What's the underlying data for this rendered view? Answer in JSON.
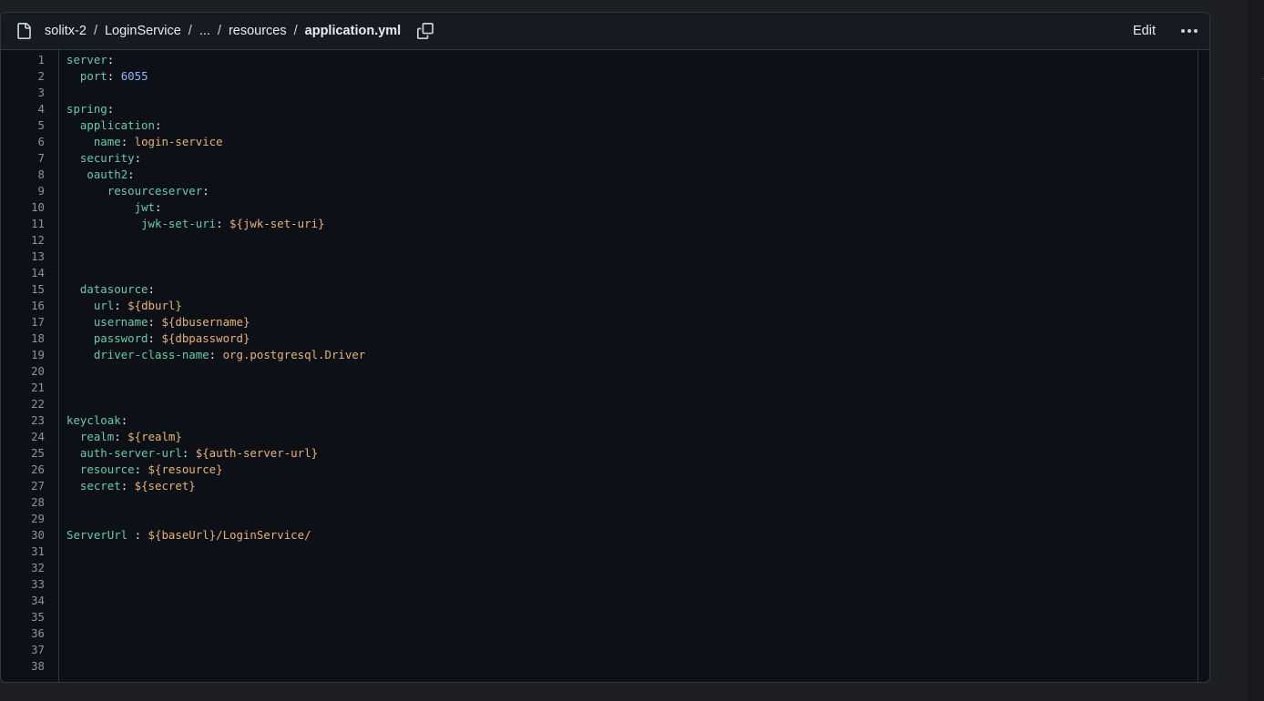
{
  "breadcrumb": {
    "repo": "solitx-2",
    "folder": "LoginService",
    "ellipsis": "...",
    "subfolder": "resources",
    "file": "application.yml",
    "separator": "/"
  },
  "header": {
    "edit_label": "Edit"
  },
  "icons": {
    "file": "file-icon",
    "copy": "copy-icon",
    "more": "kebab-more-icon"
  },
  "colors": {
    "key": "#6bc9a6",
    "string": "#e8b27a",
    "number": "#8fb4ff",
    "background": "#0d1117"
  },
  "code_lines": [
    [
      {
        "t": "k",
        "s": "server"
      },
      {
        "t": "p",
        "s": ":"
      }
    ],
    [
      {
        "t": "p",
        "s": "  "
      },
      {
        "t": "k",
        "s": "port"
      },
      {
        "t": "p",
        "s": ": "
      },
      {
        "t": "n",
        "s": "6055"
      }
    ],
    [],
    [
      {
        "t": "k",
        "s": "spring"
      },
      {
        "t": "p",
        "s": ":"
      }
    ],
    [
      {
        "t": "p",
        "s": "  "
      },
      {
        "t": "k",
        "s": "application"
      },
      {
        "t": "p",
        "s": ":"
      }
    ],
    [
      {
        "t": "p",
        "s": "    "
      },
      {
        "t": "k",
        "s": "name"
      },
      {
        "t": "p",
        "s": ": "
      },
      {
        "t": "v",
        "s": "login-service"
      }
    ],
    [
      {
        "t": "p",
        "s": "  "
      },
      {
        "t": "k",
        "s": "security"
      },
      {
        "t": "p",
        "s": ":"
      }
    ],
    [
      {
        "t": "p",
        "s": "   "
      },
      {
        "t": "k",
        "s": "oauth2"
      },
      {
        "t": "p",
        "s": ":"
      }
    ],
    [
      {
        "t": "p",
        "s": "      "
      },
      {
        "t": "k",
        "s": "resourceserver"
      },
      {
        "t": "p",
        "s": ":"
      }
    ],
    [
      {
        "t": "p",
        "s": "          "
      },
      {
        "t": "k",
        "s": "jwt"
      },
      {
        "t": "p",
        "s": ":"
      }
    ],
    [
      {
        "t": "p",
        "s": "           "
      },
      {
        "t": "k",
        "s": "jwk-set-uri"
      },
      {
        "t": "p",
        "s": ": "
      },
      {
        "t": "v",
        "s": "${jwk-set-uri}"
      }
    ],
    [],
    [],
    [],
    [
      {
        "t": "p",
        "s": "  "
      },
      {
        "t": "k",
        "s": "datasource"
      },
      {
        "t": "p",
        "s": ":"
      }
    ],
    [
      {
        "t": "p",
        "s": "    "
      },
      {
        "t": "k",
        "s": "url"
      },
      {
        "t": "p",
        "s": ": "
      },
      {
        "t": "v",
        "s": "${dburl}"
      }
    ],
    [
      {
        "t": "p",
        "s": "    "
      },
      {
        "t": "k",
        "s": "username"
      },
      {
        "t": "p",
        "s": ": "
      },
      {
        "t": "v",
        "s": "${dbusername}"
      }
    ],
    [
      {
        "t": "p",
        "s": "    "
      },
      {
        "t": "k",
        "s": "password"
      },
      {
        "t": "p",
        "s": ": "
      },
      {
        "t": "v",
        "s": "${dbpassword}"
      }
    ],
    [
      {
        "t": "p",
        "s": "    "
      },
      {
        "t": "k",
        "s": "driver-class-name"
      },
      {
        "t": "p",
        "s": ": "
      },
      {
        "t": "v",
        "s": "org.postgresql.Driver"
      }
    ],
    [],
    [],
    [],
    [
      {
        "t": "k",
        "s": "keycloak"
      },
      {
        "t": "p",
        "s": ":"
      }
    ],
    [
      {
        "t": "p",
        "s": "  "
      },
      {
        "t": "k",
        "s": "realm"
      },
      {
        "t": "p",
        "s": ": "
      },
      {
        "t": "v",
        "s": "${realm}"
      }
    ],
    [
      {
        "t": "p",
        "s": "  "
      },
      {
        "t": "k",
        "s": "auth-server-url"
      },
      {
        "t": "p",
        "s": ": "
      },
      {
        "t": "v",
        "s": "${auth-server-url}"
      }
    ],
    [
      {
        "t": "p",
        "s": "  "
      },
      {
        "t": "k",
        "s": "resource"
      },
      {
        "t": "p",
        "s": ": "
      },
      {
        "t": "v",
        "s": "${resource}"
      }
    ],
    [
      {
        "t": "p",
        "s": "  "
      },
      {
        "t": "k",
        "s": "secret"
      },
      {
        "t": "p",
        "s": ": "
      },
      {
        "t": "v",
        "s": "${secret}"
      }
    ],
    [],
    [],
    [
      {
        "t": "k",
        "s": "ServerUrl"
      },
      {
        "t": "p",
        "s": " : "
      },
      {
        "t": "v",
        "s": "${baseUrl}/LoginService/"
      }
    ],
    [],
    [],
    [],
    [],
    [],
    [],
    [],
    []
  ]
}
